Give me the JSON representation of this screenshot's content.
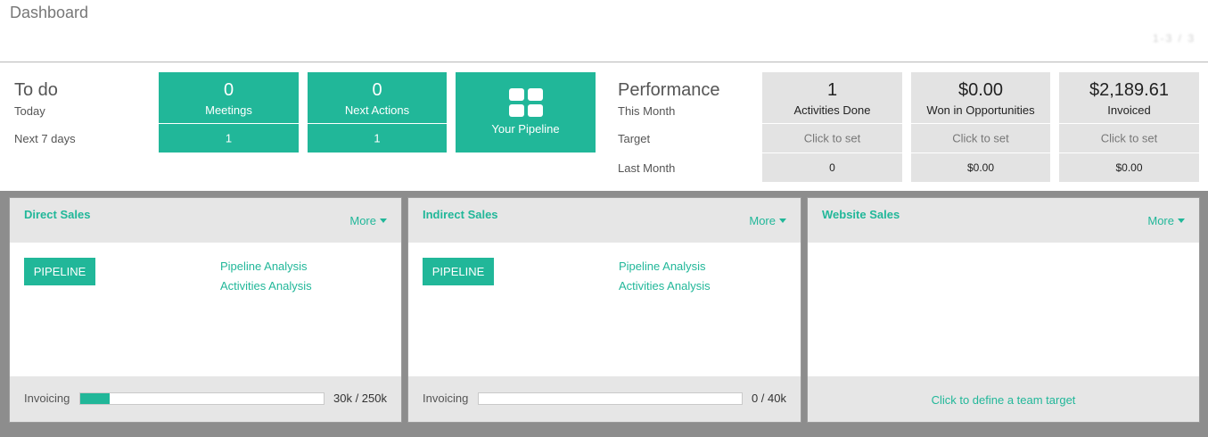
{
  "header": {
    "title": "Dashboard",
    "pager": "1-3 / 3"
  },
  "todo": {
    "title": "To do",
    "rows": {
      "today": "Today",
      "next7": "Next 7 days"
    },
    "meetings": {
      "value": "0",
      "label": "Meetings",
      "next7": "1"
    },
    "next_actions": {
      "value": "0",
      "label": "Next Actions",
      "next7": "1"
    },
    "pipeline": {
      "label": "Your Pipeline",
      "icon": "grid-icon"
    }
  },
  "performance": {
    "title": "Performance",
    "rows": {
      "this_month": "This Month",
      "target": "Target",
      "last_month": "Last Month"
    },
    "activities": {
      "value": "1",
      "label": "Activities Done",
      "target": "Click to set",
      "last": "0"
    },
    "won": {
      "value": "$0.00",
      "label": "Won in Opportunities",
      "target": "Click to set",
      "last": "$0.00"
    },
    "invoiced": {
      "value": "$2,189.61",
      "label": "Invoiced",
      "target": "Click to set",
      "last": "$0.00"
    }
  },
  "teams": [
    {
      "name": "Direct Sales",
      "more": "More",
      "pipeline": "PIPELINE",
      "links": [
        "Pipeline Analysis",
        "Activities Analysis"
      ],
      "invoicing_label": "Invoicing",
      "invoicing_value": "30k / 250k",
      "invoicing_progress": 0.12
    },
    {
      "name": "Indirect Sales",
      "more": "More",
      "pipeline": "PIPELINE",
      "links": [
        "Pipeline Analysis",
        "Activities Analysis"
      ],
      "invoicing_label": "Invoicing",
      "invoicing_value": "0 / 40k",
      "invoicing_progress": 0
    },
    {
      "name": "Website Sales",
      "more": "More",
      "target_link": "Click to define a team target"
    }
  ],
  "colors": {
    "accent": "#21b799",
    "tile_grey": "#e3e3e3",
    "board_bg": "#8d8d8d"
  }
}
